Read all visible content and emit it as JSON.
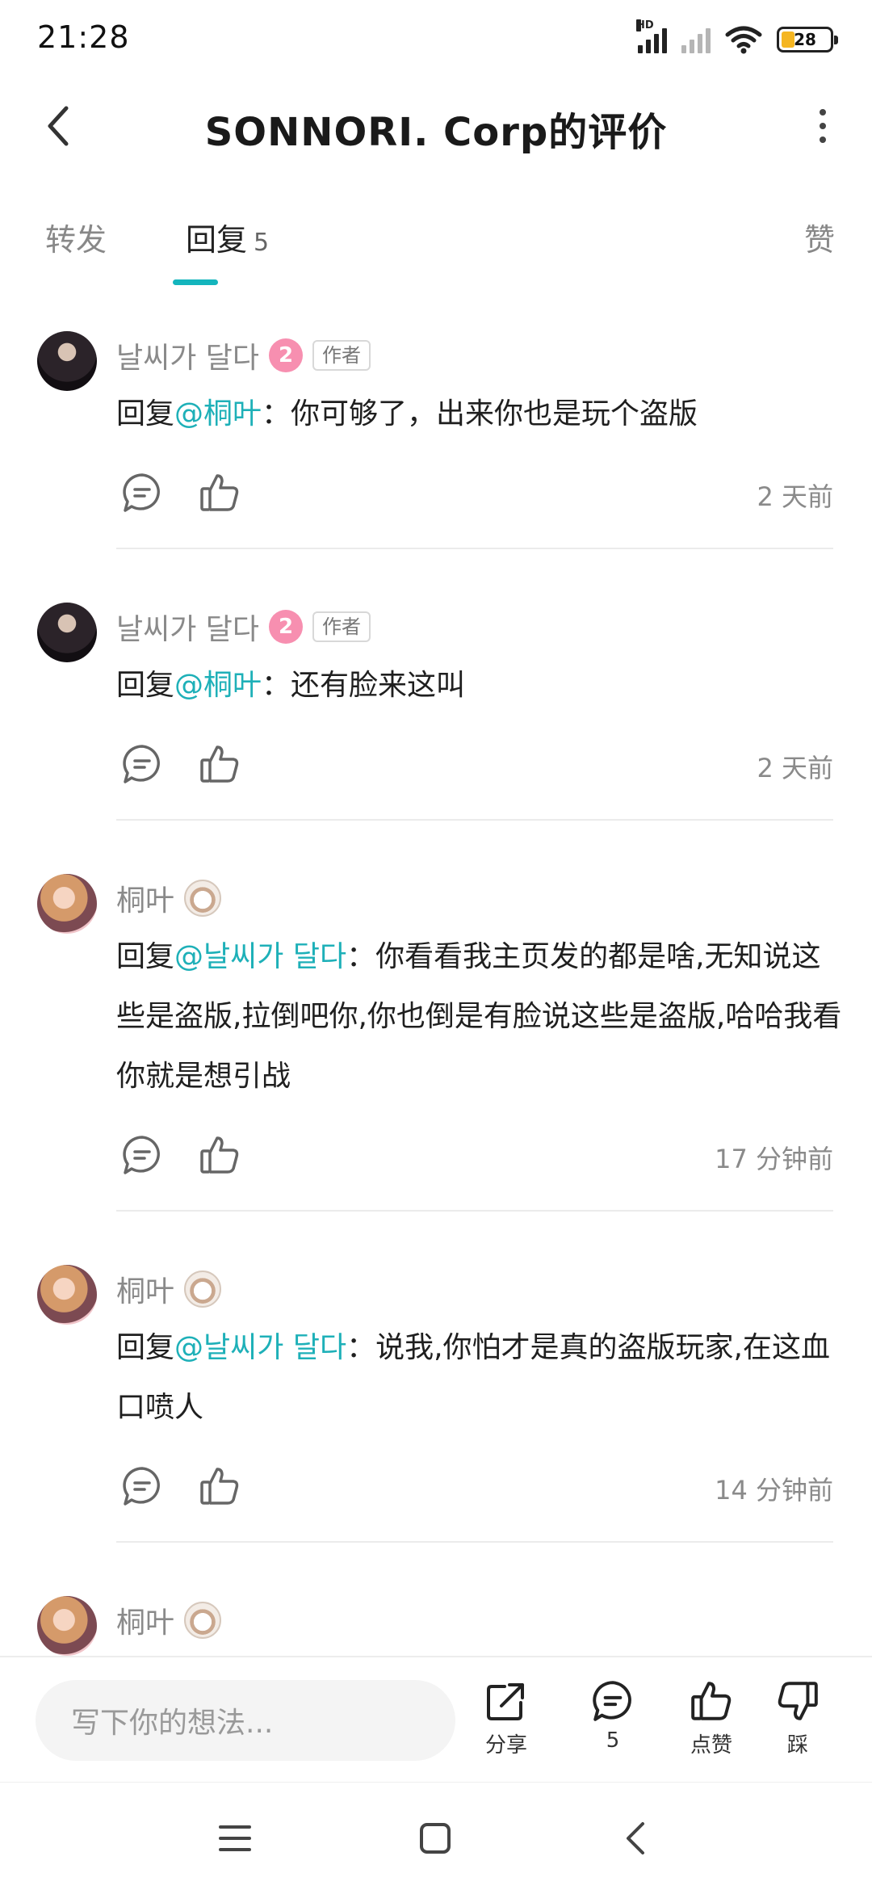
{
  "status_bar": {
    "time": "21:28",
    "network_label": "HD",
    "battery": "28",
    "battery_level": 0.28
  },
  "header": {
    "title": "SONNORI. Corp的评价"
  },
  "tabs": [
    {
      "label": "转发",
      "count": ""
    },
    {
      "label": "回复",
      "count": "5"
    },
    {
      "label": "赞",
      "count": ""
    }
  ],
  "comments": [
    {
      "username": "날씨가 달다",
      "level": "2",
      "tag": "作者",
      "reply_prefix": "回复",
      "mention": "@桐叶",
      "text": "：你可够了，出来你也是玩个盗版",
      "time": "2 天前"
    },
    {
      "username": "날씨가 달다",
      "level": "2",
      "tag": "作者",
      "reply_prefix": "回复",
      "mention": "@桐叶",
      "text": "：还有脸来这叫",
      "time": "2 天前"
    },
    {
      "username": "桐叶",
      "reply_prefix": "回复",
      "mention": "@날씨가 달다",
      "text": "：你看看我主页发的都是啥,无知说这些是盗版,拉倒吧你,你也倒是有脸说这些是盗版,哈哈我看你就是想引战",
      "time": "17 分钟前"
    },
    {
      "username": "桐叶",
      "reply_prefix": "回复",
      "mention": "@날씨가 달다",
      "text": "：说我,你怕才是真的盗版玩家,在这血口喷人",
      "time": "14 分钟前"
    },
    {
      "username": "桐叶"
    }
  ],
  "bottom_bar": {
    "input_placeholder": "写下你的想法...",
    "share_label": "分享",
    "comment_count": "5",
    "like_label": "点赞",
    "dislike_label": "踩"
  },
  "colors": {
    "accent": "#14b5bd",
    "mention": "#1eb0b8",
    "level_badge": "#f78fb0"
  },
  "icons": [
    "back-icon",
    "more-icon",
    "comment-icon",
    "like-icon",
    "share-icon",
    "dislike-icon",
    "menu-icon",
    "home-icon",
    "nav-back-icon"
  ]
}
